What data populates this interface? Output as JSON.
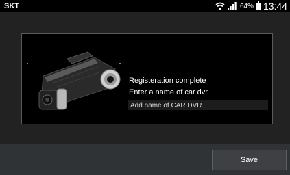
{
  "status_bar": {
    "carrier": "SKT",
    "battery_percent": "64%",
    "time": "13:44",
    "icons": [
      "wifi-icon",
      "signal-icon",
      "battery-icon"
    ]
  },
  "registration": {
    "message_line1": "Registeration complete",
    "message_line2": "Enter a name of car dvr",
    "name_input_placeholder": "Add name of CAR DVR.",
    "name_input_value": ""
  },
  "footer": {
    "save_label": "Save"
  },
  "colors": {
    "background": "#222222",
    "card": "#000000",
    "bottom_bar": "#303336",
    "button": "#3e4043"
  }
}
